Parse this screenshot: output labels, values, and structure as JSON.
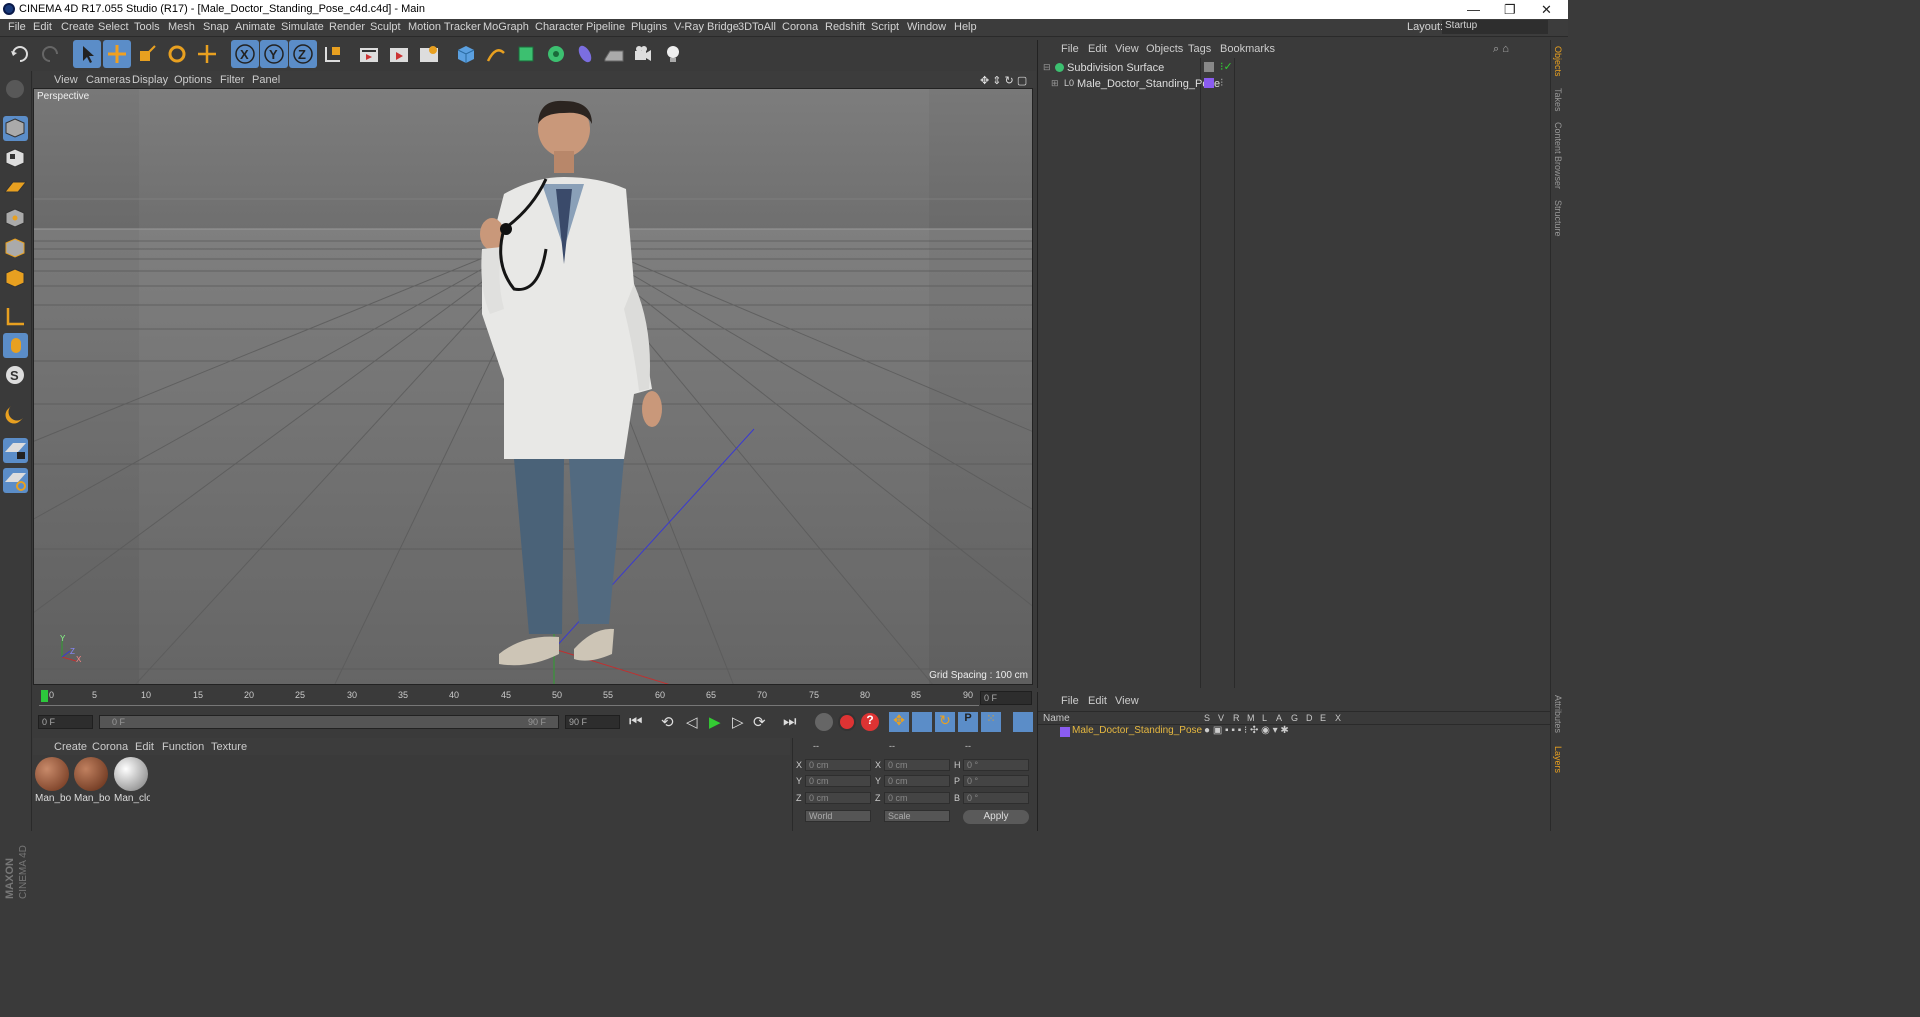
{
  "window": {
    "title": "CINEMA 4D R17.055 Studio (R17) - [Male_Doctor_Standing_Pose_c4d.c4d] - Main",
    "minimize": "—",
    "restore": "❐",
    "close": "✕"
  },
  "menubar": {
    "items": [
      "File",
      "Edit",
      "Create",
      "Select",
      "Tools",
      "Mesh",
      "Snap",
      "Animate",
      "Simulate",
      "Render",
      "Sculpt",
      "Motion Tracker",
      "MoGraph",
      "Character",
      "Pipeline",
      "Plugins",
      "V-Ray Bridge",
      "3DToAll",
      "Corona",
      "Redshift",
      "Script",
      "Window",
      "Help"
    ],
    "layout_label": "Layout:",
    "layout_value": "Startup"
  },
  "viewport": {
    "menu": [
      "View",
      "Cameras",
      "Display",
      "Options",
      "Filter",
      "Panel"
    ],
    "camera_label": "Perspective",
    "grid_spacing": "Grid Spacing : 100 cm"
  },
  "timeline": {
    "ticks": [
      "0",
      "5",
      "10",
      "15",
      "20",
      "25",
      "30",
      "35",
      "40",
      "45",
      "50",
      "55",
      "60",
      "65",
      "70",
      "75",
      "80",
      "85",
      "90"
    ],
    "current_frame": "0 F",
    "start_field": "0 F",
    "range_start": "0 F",
    "range_end": "90 F",
    "end_field": "90 F"
  },
  "materials": {
    "menu": [
      "Create",
      "Corona",
      "Edit",
      "Function",
      "Texture"
    ],
    "items": [
      {
        "label": "Man_bo",
        "color": "#8a4a2a"
      },
      {
        "label": "Man_bo",
        "color": "#7a3e22"
      },
      {
        "label": "Man_clo",
        "color": "#ececec"
      }
    ]
  },
  "coords": {
    "headers": [
      "--",
      "--",
      "--"
    ],
    "rows": [
      {
        "a": "X",
        "av": "0 cm",
        "b": "X",
        "bv": "0 cm",
        "c": "H",
        "cv": "0 °"
      },
      {
        "a": "Y",
        "av": "0 cm",
        "b": "Y",
        "bv": "0 cm",
        "c": "P",
        "cv": "0 °"
      },
      {
        "a": "Z",
        "av": "0 cm",
        "b": "Z",
        "bv": "0 cm",
        "c": "B",
        "cv": "0 °"
      }
    ],
    "world": "World",
    "scale": "Scale",
    "apply": "Apply"
  },
  "objects": {
    "menu": [
      "File",
      "Edit",
      "View",
      "Objects",
      "Tags",
      "Bookmarks"
    ],
    "items": [
      {
        "name": "Subdivision Surface"
      },
      {
        "name": "Male_Doctor_Standing_Pose"
      }
    ]
  },
  "layers": {
    "menu": [
      "File",
      "Edit",
      "View"
    ],
    "name_header": "Name",
    "col_headers": [
      "S",
      "V",
      "R",
      "M",
      "L",
      "A",
      "G",
      "D",
      "E",
      "X"
    ],
    "row": "Male_Doctor_Standing_Pose"
  },
  "sidetabs": [
    "Objects",
    "Takes",
    "Content Browser",
    "Structure",
    "Attributes",
    "Layers"
  ],
  "brand": {
    "maxon": "MAXON",
    "c4d": "CINEMA 4D"
  },
  "axis": {
    "y": "Y",
    "x": "X",
    "z": "Z"
  },
  "colors": {
    "accent": "#5b8dc8",
    "viewport": "#6e6e6e",
    "layer_name": "#e6b840",
    "layer_swatch": "#8a5cf0"
  }
}
